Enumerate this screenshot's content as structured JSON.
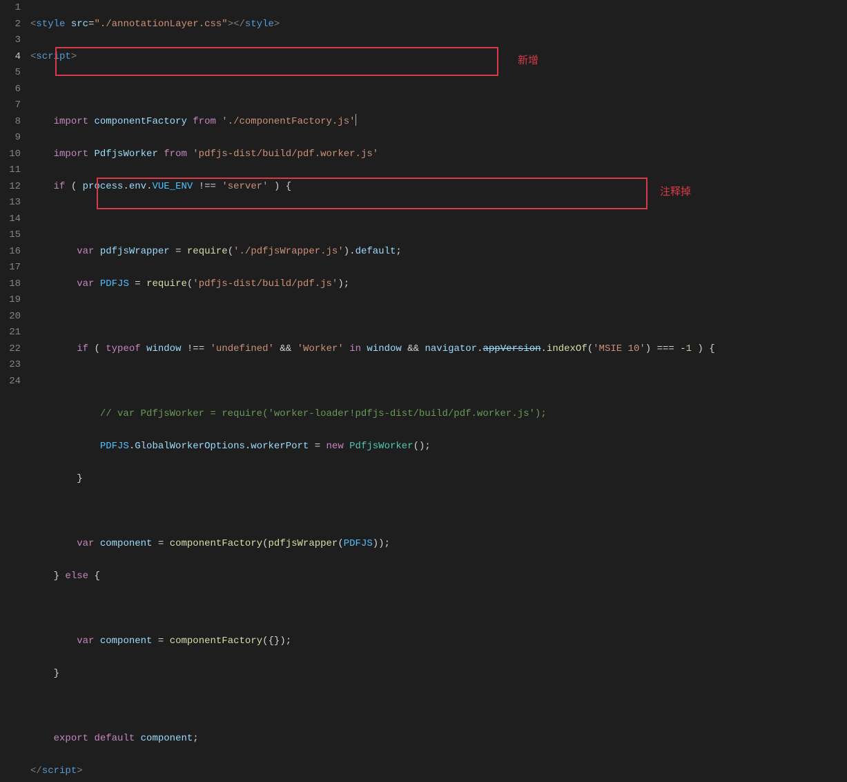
{
  "lineCount": 24,
  "activeLine": 4,
  "annotations": {
    "add": "新增",
    "commentOut": "注释掉"
  },
  "tokens": {
    "style": "style",
    "script": "script",
    "src": "src",
    "srcVal": "\"./annotationLayer.css\"",
    "import": "import",
    "from": "from",
    "componentFactory": "componentFactory",
    "componentFactoryPath": "'./componentFactory.js'",
    "PdfjsWorker": "PdfjsWorker",
    "pdfjsWorkerPath": "'pdfjs-dist/build/pdf.worker.js'",
    "if": "if",
    "process": "process",
    "env": "env",
    "VUE_ENV": "VUE_ENV",
    "serverStr": "'server'",
    "var": "var",
    "pdfjsWrapper": "pdfjsWrapper",
    "require": "require",
    "pdfjsWrapperPath": "'./pdfjsWrapper.js'",
    "default": "default",
    "PDFJS": "PDFJS",
    "pdfJsPath": "'pdfjs-dist/build/pdf.js'",
    "typeof": "typeof",
    "window": "window",
    "undefinedStr": "'undefined'",
    "WorkerStr": "'Worker'",
    "in": "in",
    "navigator": "navigator",
    "appVersion": "appVersion",
    "indexOf": "indexOf",
    "msieStr": "'MSIE 10'",
    "minus1": "1",
    "commentLine": "// var PdfjsWorker = require('worker-loader!pdfjs-dist/build/pdf.worker.js');",
    "GlobalWorkerOptions": "GlobalWorkerOptions",
    "workerPort": "workerPort",
    "new": "new",
    "component": "component",
    "else": "else",
    "export": "export",
    "defaultKw": "default"
  }
}
